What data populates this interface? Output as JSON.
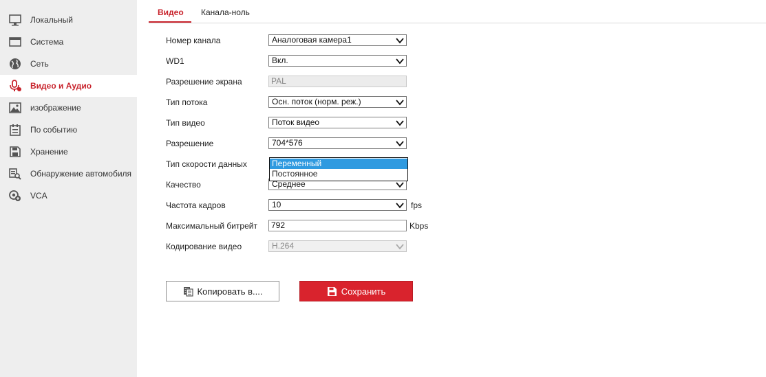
{
  "sidebar": {
    "items": [
      {
        "label": "Локальный",
        "icon": "monitor-icon"
      },
      {
        "label": "Система",
        "icon": "window-icon"
      },
      {
        "label": "Сеть",
        "icon": "globe-icon"
      },
      {
        "label": "Видео и Аудио",
        "icon": "microphone-icon",
        "active": true
      },
      {
        "label": "изображение",
        "icon": "image-icon"
      },
      {
        "label": "По событию",
        "icon": "calendar-icon"
      },
      {
        "label": "Хранение",
        "icon": "floppy-icon"
      },
      {
        "label": "Обнаружение автомобиля",
        "icon": "car-search-icon"
      },
      {
        "label": "VCA",
        "icon": "vca-icon"
      }
    ]
  },
  "tabs": [
    {
      "label": "Видео",
      "active": true
    },
    {
      "label": "Канала-ноль"
    }
  ],
  "form": {
    "channel_number": {
      "label": "Номер канала",
      "value": "Аналоговая камера1"
    },
    "wd1": {
      "label": "WD1",
      "value": "Вкл."
    },
    "resolution_screen": {
      "label": "Разрешение экрана",
      "value": "PAL"
    },
    "stream_type": {
      "label": "Тип потока",
      "value": "Осн. поток (норм. реж.)"
    },
    "video_type": {
      "label": "Тип видео",
      "value": "Поток видео"
    },
    "resolution": {
      "label": "Разрешение",
      "value": "704*576"
    },
    "bitrate_type": {
      "label": "Тип скорости данных",
      "options": [
        "Переменный",
        "Постоянное"
      ],
      "highlighted": "Переменный"
    },
    "quality": {
      "label": "Качество",
      "value": "Среднее"
    },
    "frame_rate": {
      "label": "Частота кадров",
      "value": "10",
      "unit": "fps"
    },
    "max_bitrate": {
      "label": "Максимальный битрейт",
      "value": "792",
      "unit": "Kbps"
    },
    "video_encoding": {
      "label": "Кодирование видео",
      "value": "H.264"
    }
  },
  "buttons": {
    "copy": "Копировать в....",
    "save": "Сохранить"
  },
  "colors": {
    "accent": "#c8232c",
    "save_bg": "#d9232d",
    "sidebar_bg": "#eeeeee",
    "dropdown_highlight": "#2f9ae0"
  }
}
